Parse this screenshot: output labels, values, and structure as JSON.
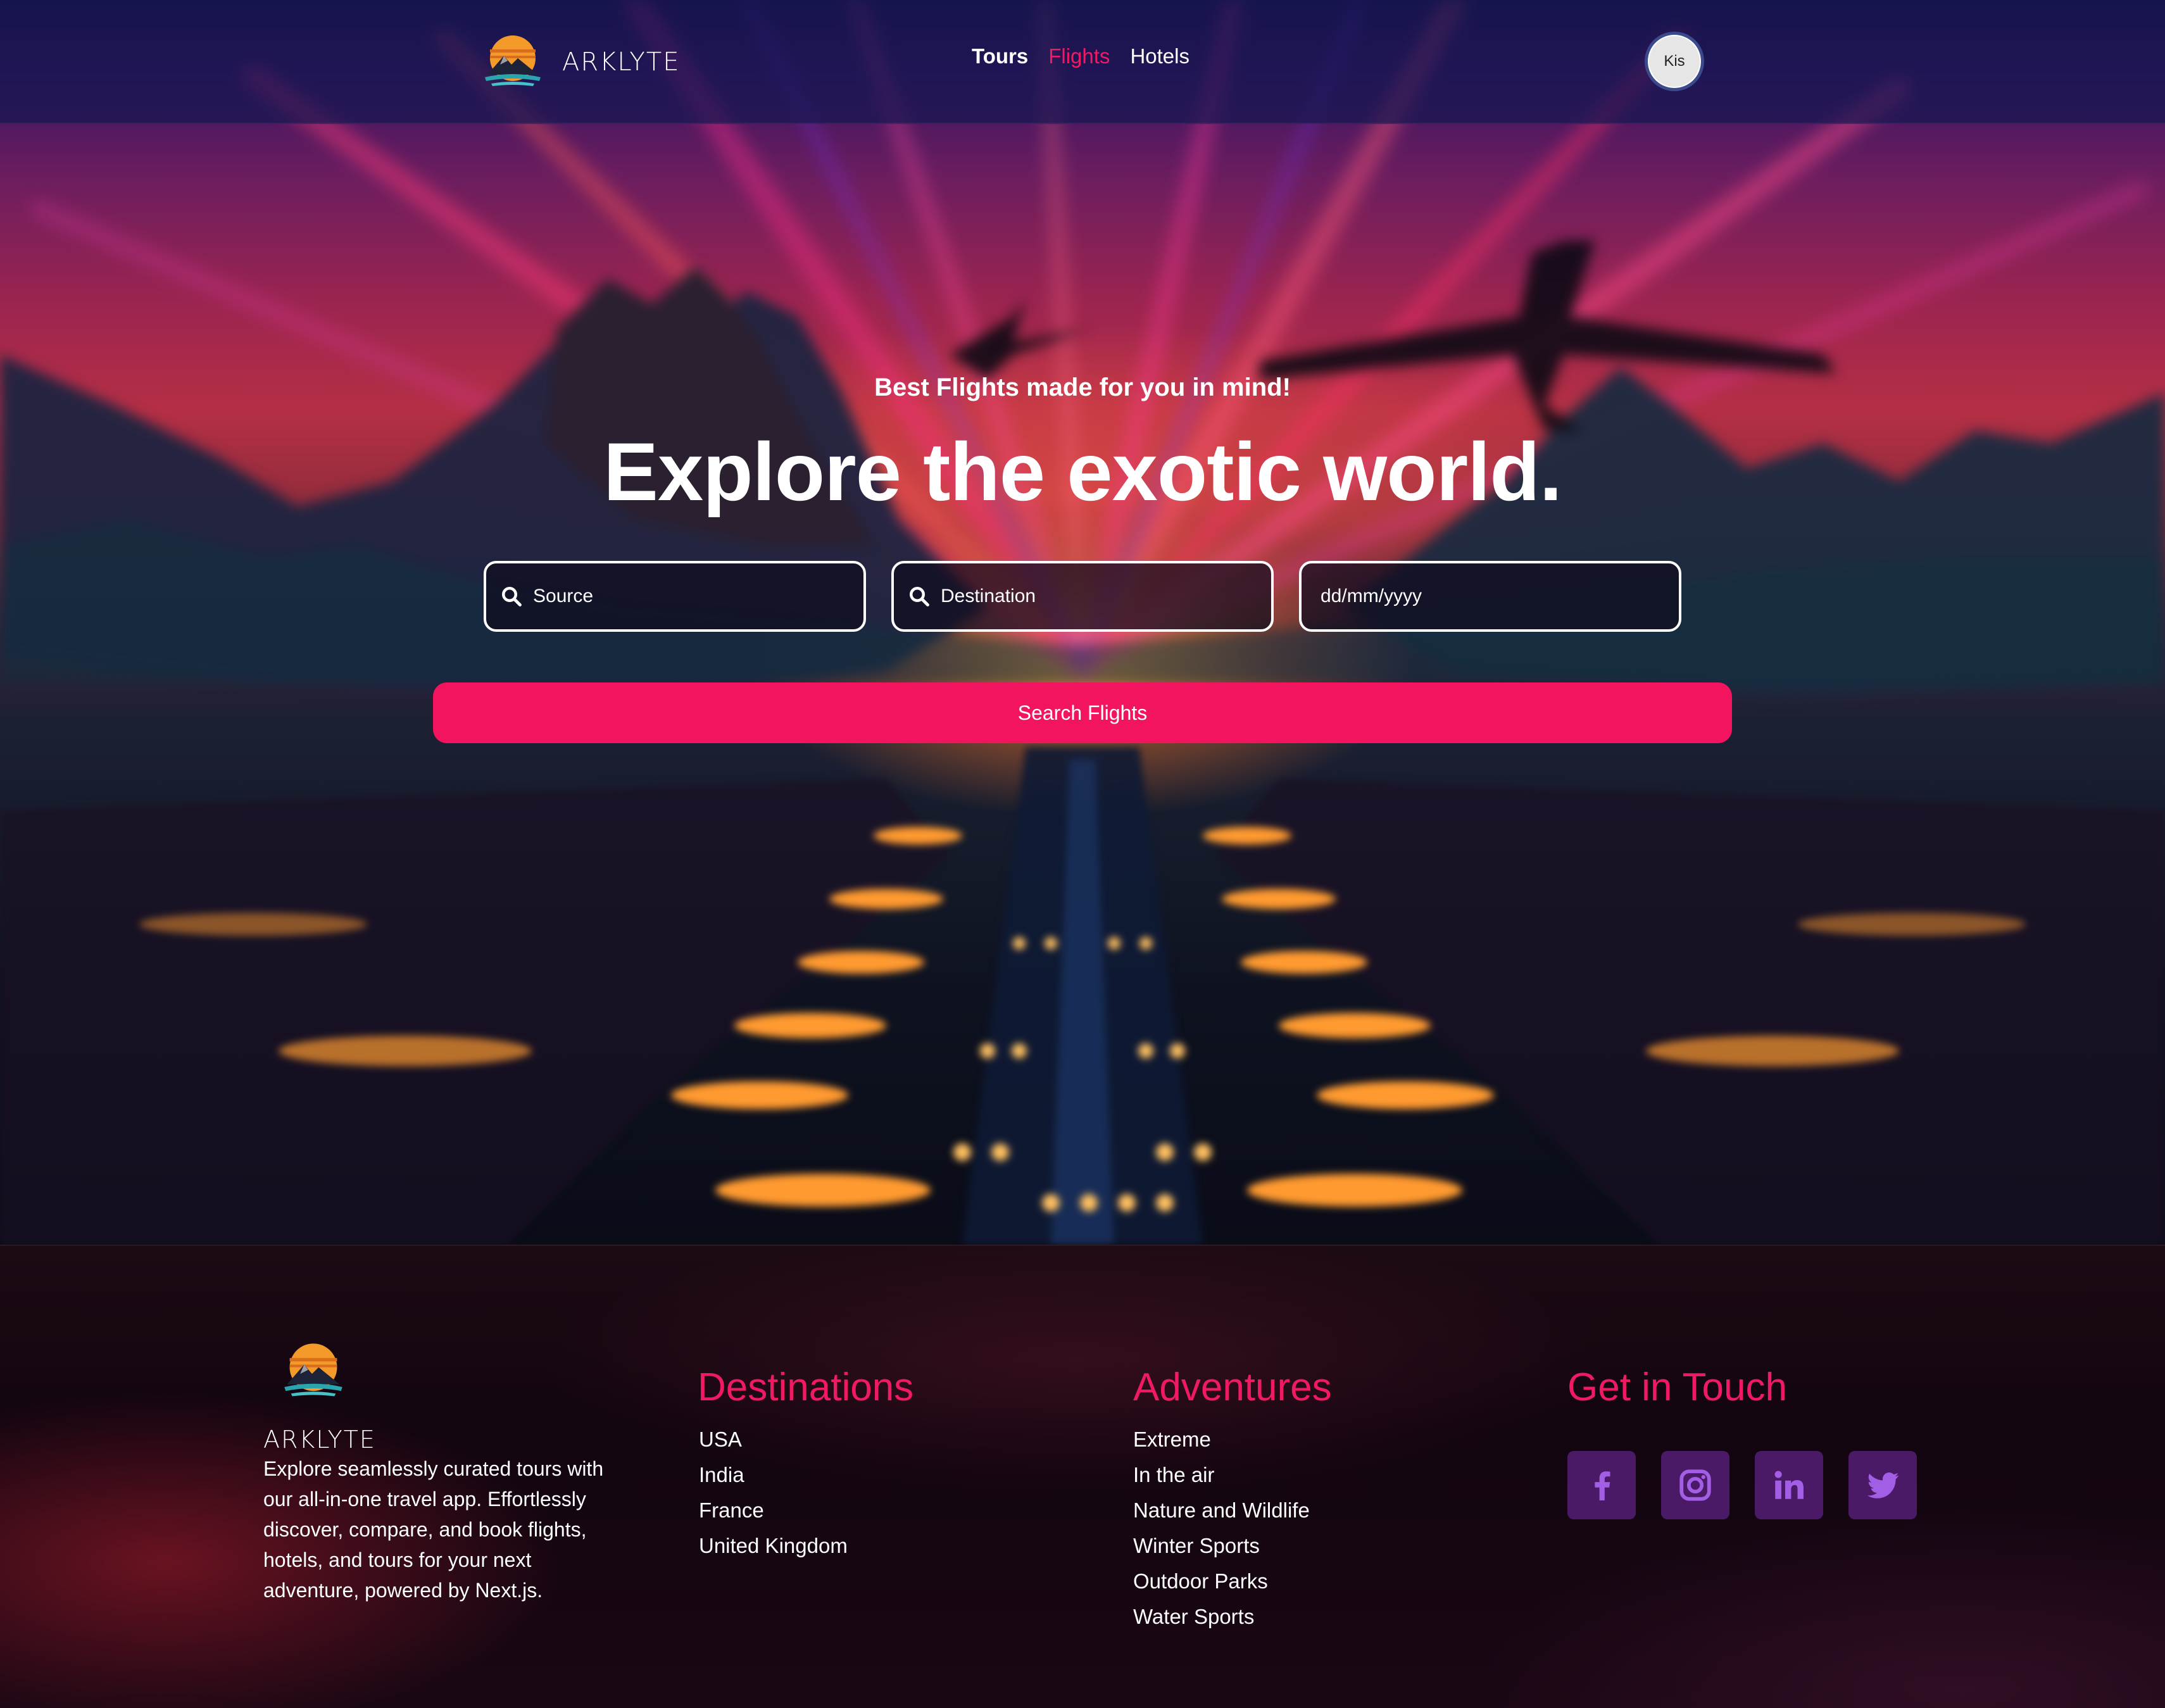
{
  "brand": {
    "name": "ARKLYTE"
  },
  "nav": {
    "links": [
      {
        "label": "Tours",
        "active": false
      },
      {
        "label": "Flights",
        "active": true
      },
      {
        "label": "Hotels",
        "active": false
      }
    ],
    "avatar_text": "Kis"
  },
  "hero": {
    "subtitle": "Best Flights made for you in mind!",
    "title": "Explore the exotic world.",
    "source_placeholder": "Source",
    "destination_placeholder": "Destination",
    "date_placeholder": "dd/mm/yyyy",
    "search_button": "Search Flights"
  },
  "footer": {
    "brand": "ARKLYTE",
    "description": "Explore seamlessly curated tours with our all-in-one travel app. Effortlessly discover, compare, and book flights, hotels, and tours for your next adventure, powered by Next.js.",
    "destinations": {
      "title": "Destinations",
      "items": [
        "USA",
        "India",
        "France",
        "United Kingdom"
      ]
    },
    "adventures": {
      "title": "Adventures",
      "items": [
        "Extreme",
        "In the air",
        "Nature and Wildlife",
        "Winter Sports",
        "Outdoor Parks",
        "Water Sports"
      ]
    },
    "contact": {
      "title": "Get in Touch",
      "socials": [
        "facebook-icon",
        "instagram-icon",
        "linkedin-icon",
        "twitter-icon"
      ]
    }
  },
  "colors": {
    "accent": "#f2145f",
    "social_bg": "#4a1a66",
    "social_icon": "#a35ee6"
  }
}
